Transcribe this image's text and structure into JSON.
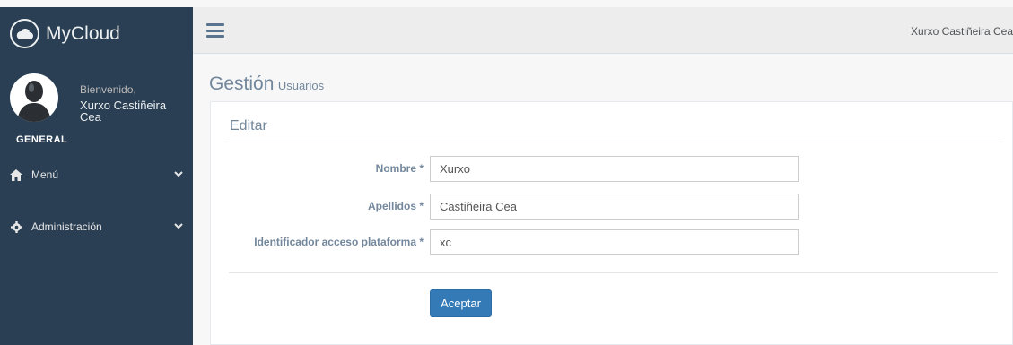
{
  "brand": {
    "name": "MyCloud"
  },
  "profile": {
    "welcome": "Bienvenido,",
    "username": "Xurxo Castiñeira Cea"
  },
  "sidebar": {
    "section": "GENERAL",
    "items": [
      {
        "label": "Menú",
        "icon": "home-icon"
      },
      {
        "label": "Administración",
        "icon": "gear-icon"
      }
    ]
  },
  "topbar": {
    "user": "Xurxo Castiñeira Cea"
  },
  "page": {
    "title": "Gestión",
    "subtitle": "Usuarios"
  },
  "panel": {
    "title": "Editar"
  },
  "form": {
    "fields": [
      {
        "label": "Nombre *",
        "value": "Xurxo"
      },
      {
        "label": "Apellidos *",
        "value": "Castiñeira Cea"
      },
      {
        "label": "Identificador acceso plataforma *",
        "value": "xc"
      }
    ],
    "submit_label": "Aceptar"
  },
  "colors": {
    "sidebar": "#2a3f54",
    "primary": "#337ab7"
  }
}
